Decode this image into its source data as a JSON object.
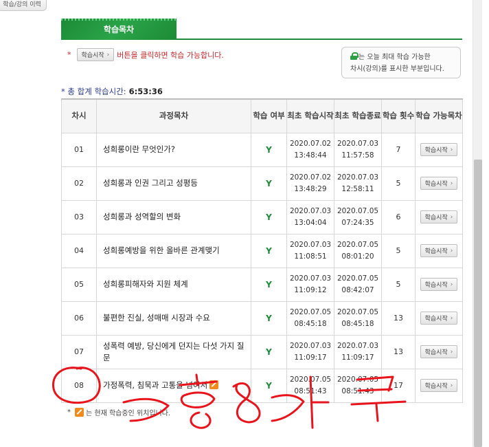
{
  "top_button": {
    "label": "학습/강의 이력"
  },
  "section_tab": {
    "label": "학습목차"
  },
  "notice": {
    "marker": "*",
    "button_label": "학습시작",
    "text": "버튼을 클릭하면 학습 가능합니다."
  },
  "legend": {
    "line1": "는 오늘 최대 학습 가능한",
    "line2": "차시(강의)를 표시한 부분입니다."
  },
  "total": {
    "label": "* 총 합계 학습시간:",
    "value": "6:53:36"
  },
  "table": {
    "headers": [
      "차시",
      "과정목차",
      "학습 여부",
      "최초 학습시작",
      "최초 학습종료",
      "학습 횟수",
      "학습 가능목차"
    ],
    "rows": [
      {
        "no": "01",
        "title": "성희롱이란 무엇인가?",
        "done": "Y",
        "start_date": "2020.07.02",
        "start_time": "13:48:44",
        "end_date": "2020.07.03",
        "end_time": "11:57:58",
        "count": "7",
        "action": "학습시작"
      },
      {
        "no": "02",
        "title": "성희롱과 인권 그리고 성평등",
        "done": "Y",
        "start_date": "2020.07.02",
        "start_time": "13:48:29",
        "end_date": "2020.07.03",
        "end_time": "12:58:11",
        "count": "5",
        "action": "학습시작"
      },
      {
        "no": "03",
        "title": "성희롱과 성역할의 변화",
        "done": "Y",
        "start_date": "2020.07.03",
        "start_time": "13:04:04",
        "end_date": "2020.07.05",
        "end_time": "07:24:35",
        "count": "6",
        "action": "학습시작"
      },
      {
        "no": "04",
        "title": "성희롱예방을 위한 올바른 관계맺기",
        "done": "Y",
        "start_date": "2020.07.03",
        "start_time": "11:08:51",
        "end_date": "2020.07.05",
        "end_time": "08:01:20",
        "count": "5",
        "action": "학습시작"
      },
      {
        "no": "05",
        "title": "성희롱피해자와 지원 체계",
        "done": "Y",
        "start_date": "2020.07.03",
        "start_time": "11:09:12",
        "end_date": "2020.07.05",
        "end_time": "08:42:07",
        "count": "5",
        "action": "학습시작"
      },
      {
        "no": "06",
        "title": "불편한 진실, 성매매 시장과 수요",
        "done": "Y",
        "start_date": "2020.07.05",
        "start_time": "08:45:18",
        "end_date": "2020.07.05",
        "end_time": "08:45:18",
        "count": "13",
        "action": "학습시작"
      },
      {
        "no": "07",
        "title": "성폭력 예방, 당신에게 던지는 다섯 가지 질문",
        "done": "Y",
        "start_date": "2020.07.03",
        "start_time": "11:09:17",
        "end_date": "2020.07.03",
        "end_time": "11:09:17",
        "count": "13",
        "action": "학습시작"
      },
      {
        "no": "08",
        "title": "가정폭력, 침묵과 고통을 넘어서",
        "done": "Y",
        "start_date": "2020.07.05",
        "start_time": "08:51:43",
        "end_date": "2020.07.05",
        "end_time": "08:51:43",
        "count": "17",
        "action": "학습시작",
        "current": true
      }
    ]
  },
  "footnote": {
    "marker": "*",
    "text": "는 현재 학습중인 위치입니다."
  },
  "annotation": {
    "text": "총 8 과목",
    "color": "#e8141c"
  }
}
